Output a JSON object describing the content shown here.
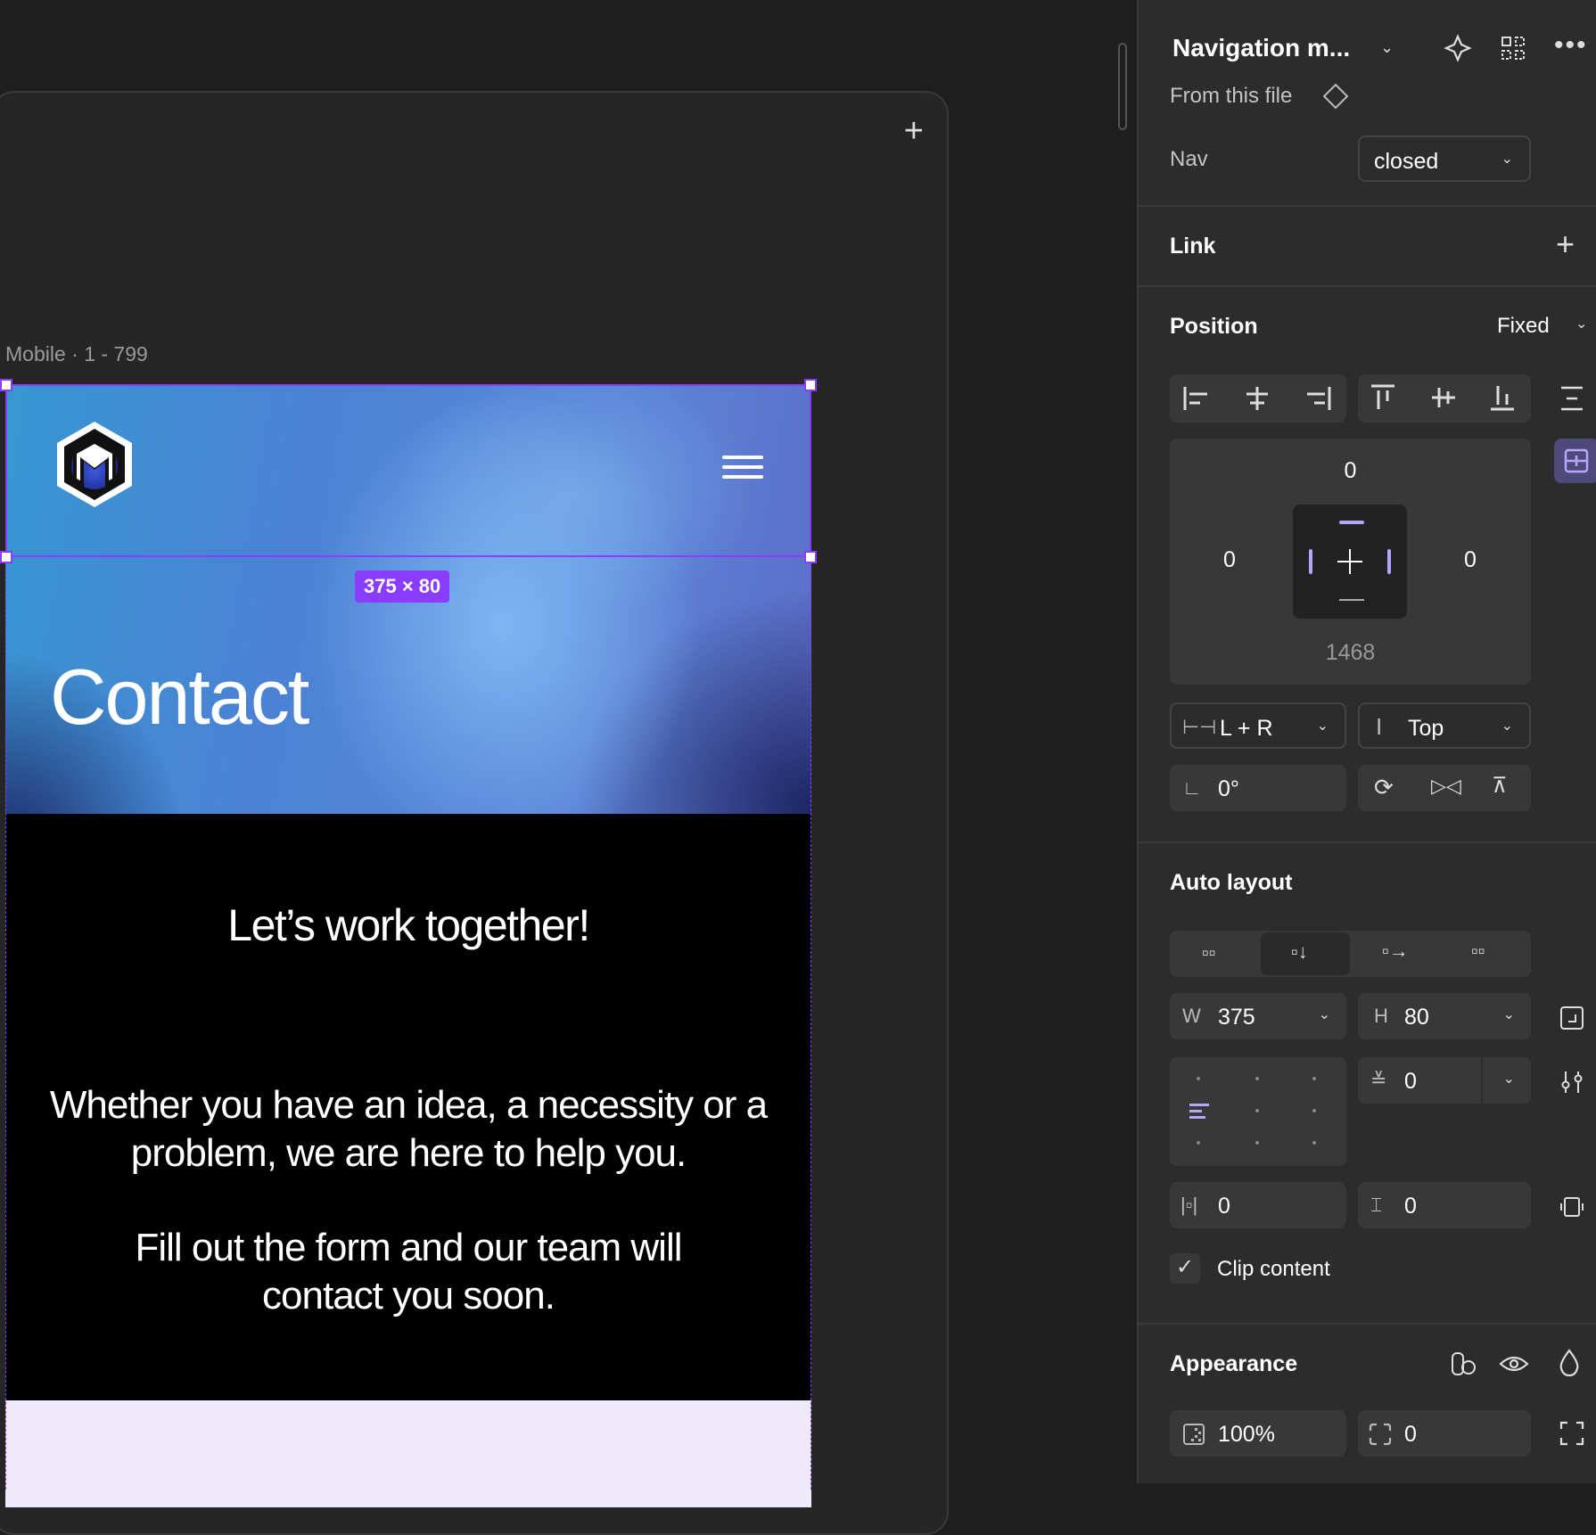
{
  "canvas": {
    "frame_label": "Mobile · 1 - 799",
    "selection_size": "375 × 80",
    "hero_title": "Contact",
    "heading": "Let’s work together!",
    "paragraph1": "Whether you have an idea, a necessity or a problem, we are here to help you.",
    "paragraph2": "Fill out the form and our team will contact you soon.",
    "add_icon": "plus-icon",
    "colors": {
      "selection": "#8b3dff",
      "dark_bg": "#000000",
      "light_bg": "#eeeafc"
    }
  },
  "panel": {
    "component_name": "Navigation m...",
    "source": "From this file",
    "nav_label": "Nav",
    "nav_value": "closed",
    "link_title": "Link",
    "position_title": "Position",
    "position_value": "Fixed",
    "constraints": {
      "top": "0",
      "left": "0",
      "right": "0",
      "bottom": "1468"
    },
    "h_constraint": "L + R",
    "v_constraint": "Top",
    "rotation": "0°",
    "autolayout_title": "Auto layout",
    "width_label": "W",
    "width": "375",
    "height_label": "H",
    "height": "80",
    "gap": "0",
    "padding_h": "0",
    "padding_v": "0",
    "clip_content": "Clip content",
    "appearance_title": "Appearance",
    "opacity": "100%",
    "radius": "0"
  }
}
